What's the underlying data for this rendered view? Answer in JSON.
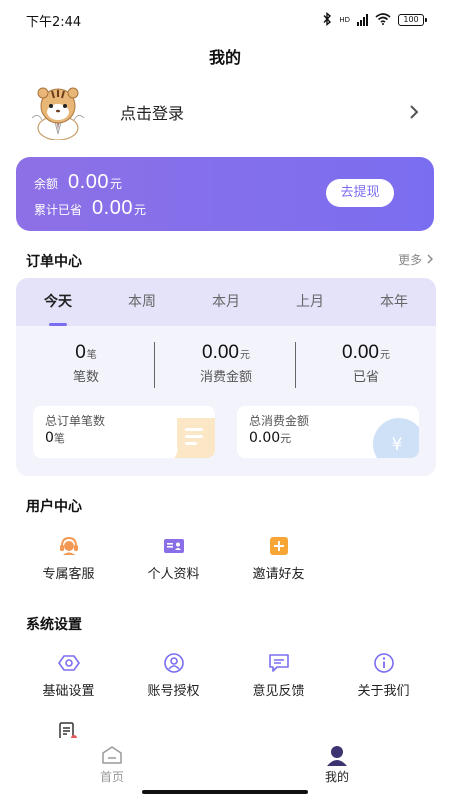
{
  "status_bar": {
    "time": "下午2:44",
    "battery": "100",
    "network": "HD"
  },
  "header": {
    "title": "我的"
  },
  "login": {
    "text": "点击登录"
  },
  "balance": {
    "balance_label": "余额",
    "balance_value": "0.00",
    "balance_unit": "元",
    "saved_label": "累计已省",
    "saved_value": "0.00",
    "saved_unit": "元",
    "withdraw_button": "去提现"
  },
  "orders": {
    "title": "订单中心",
    "more": "更多",
    "tabs": [
      "今天",
      "本周",
      "本月",
      "上月",
      "本年"
    ],
    "active_tab": 0,
    "stats": [
      {
        "value": "0",
        "unit": "笔",
        "label": "笔数"
      },
      {
        "value": "0.00",
        "unit": "元",
        "label": "消费金额"
      },
      {
        "value": "0.00",
        "unit": "元",
        "label": "已省"
      }
    ],
    "total_orders": {
      "label": "总订单笔数",
      "value": "0",
      "unit": "笔"
    },
    "total_amount": {
      "label": "总消费金额",
      "value": "0.00",
      "unit": "元",
      "icon_glyph": "¥"
    }
  },
  "user_center": {
    "title": "用户中心",
    "items": [
      {
        "label": "专属客服",
        "icon": "customer-service-icon"
      },
      {
        "label": "个人资料",
        "icon": "id-card-icon"
      },
      {
        "label": "邀请好友",
        "icon": "invite-plus-icon"
      }
    ]
  },
  "system_settings": {
    "title": "系统设置",
    "items": [
      {
        "label": "基础设置",
        "icon": "settings-hex-icon"
      },
      {
        "label": "账号授权",
        "icon": "account-auth-icon"
      },
      {
        "label": "意见反馈",
        "icon": "feedback-icon"
      },
      {
        "label": "关于我们",
        "icon": "info-icon"
      }
    ]
  },
  "bottom_nav": {
    "items": [
      {
        "label": "首页",
        "icon": "home-icon",
        "active": false
      },
      {
        "label": "我的",
        "icon": "user-icon",
        "active": true
      }
    ]
  },
  "colors": {
    "accent": "#7a6ef0",
    "accent_light": "#e4e3fa",
    "card_bg": "#f3f3fc",
    "icon_orange": "#f29a55",
    "icon_purple": "#8a6ee8"
  }
}
